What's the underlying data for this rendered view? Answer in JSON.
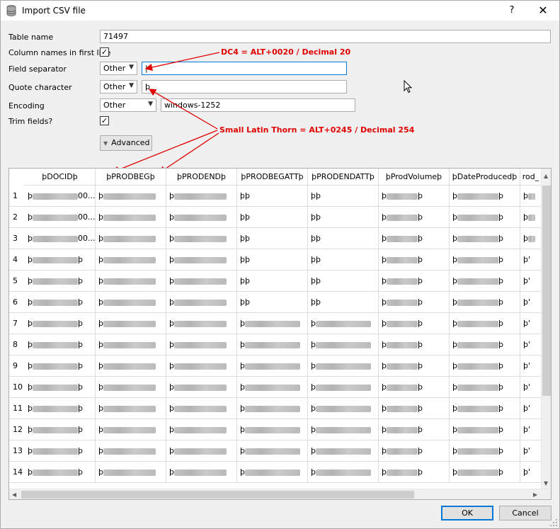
{
  "window": {
    "title": "Import CSV file",
    "help_glyph": "?",
    "close_glyph": "✕"
  },
  "form": {
    "table_name_label": "Table name",
    "table_name_value": "71497",
    "column_names_label": "Column names in first line",
    "column_names_checked": "✓",
    "field_separator_label": "Field separator",
    "field_separator_option": "Other",
    "field_separator_value": "|",
    "quote_char_label": "Quote character",
    "quote_char_option": "Other",
    "quote_char_value": "þ",
    "encoding_label": "Encoding",
    "encoding_option": "Other",
    "encoding_value": "windows-1252",
    "trim_fields_label": "Trim fields?",
    "trim_fields_checked": "✓",
    "advanced_label": "Advanced"
  },
  "annotations": {
    "dc4": "DC4 = ALT+0020 / Decimal 20",
    "thorn": "Small Latin Thorn = ALT+0245 / Decimal 254",
    "color": "#e00000"
  },
  "preview": {
    "columns": [
      "þDOCIDþ",
      "þPRODBEGþ",
      "þPRODENDþ",
      "þPRODBEGATTþ",
      "þPRODENDATTþ",
      "þProdVolumeþ",
      "þDateProducedþ",
      "rod_"
    ],
    "rows": [
      {
        "num": "1",
        "cells": [
          "þ▒▒▒▒▒00...",
          "þ▒▒▒▒▒▒▒",
          "þ▒▒▒▒▒▒▒",
          "þþ",
          "þþ",
          "þ▒▒▒▒þ",
          "þ▒▒▒▒▒▒þ",
          "þ▒"
        ]
      },
      {
        "num": "2",
        "cells": [
          "þ▒▒▒▒▒00...",
          "þ▒▒▒▒▒▒▒",
          "þ▒▒▒▒▒▒▒",
          "þþ",
          "þþ",
          "þ▒▒▒▒þ",
          "þ▒▒▒▒▒▒þ",
          "þ▒"
        ]
      },
      {
        "num": "3",
        "cells": [
          "þ▒▒▒▒▒00...",
          "þ▒▒▒▒▒▒▒",
          "þ▒▒▒▒▒▒▒",
          "þþ",
          "þþ",
          "þ▒▒▒▒þ",
          "þ▒▒▒▒▒▒þ",
          "þ▒"
        ]
      },
      {
        "num": "4",
        "cells": [
          "þ▒▒▒▒▒þ",
          "þ▒▒▒▒▒▒▒",
          "þ▒▒▒▒▒▒▒",
          "þþ",
          "þþ",
          "þ▒▒▒▒þ",
          "þ▒▒▒▒▒▒þ",
          "þ'"
        ]
      },
      {
        "num": "5",
        "cells": [
          "þ▒▒▒▒▒þ",
          "þ▒▒▒▒▒▒▒",
          "þ▒▒▒▒▒▒▒",
          "þþ",
          "þþ",
          "þ▒▒▒▒þ",
          "þ▒▒▒▒▒▒þ",
          "þ'"
        ]
      },
      {
        "num": "6",
        "cells": [
          "þ▒▒▒▒▒þ",
          "þ▒▒▒▒▒▒▒",
          "þ▒▒▒▒▒▒▒",
          "þþ",
          "þþ",
          "þ▒▒▒▒þ",
          "þ▒▒▒▒▒▒þ",
          "þ'"
        ]
      },
      {
        "num": "7",
        "cells": [
          "þ▒▒▒▒▒þ",
          "þ▒▒▒▒▒▒▒",
          "þ▒▒▒▒▒▒▒",
          "þ▒▒▒▒▒▒",
          "þ▒▒▒▒▒▒",
          "þ▒▒▒▒þ",
          "þ▒▒▒▒▒▒þ",
          "þ'"
        ]
      },
      {
        "num": "8",
        "cells": [
          "þ▒▒▒▒▒þ",
          "þ▒▒▒▒▒▒▒",
          "þ▒▒▒▒▒▒▒",
          "þ▒▒▒▒▒▒",
          "þ▒▒▒▒▒▒",
          "þ▒▒▒▒þ",
          "þ▒▒▒▒▒▒þ",
          "þ'"
        ]
      },
      {
        "num": "9",
        "cells": [
          "þ▒▒▒▒▒þ",
          "þ▒▒▒▒▒▒▒",
          "þ▒▒▒▒▒▒▒",
          "þ▒▒▒▒▒▒",
          "þ▒▒▒▒▒▒",
          "þ▒▒▒▒þ",
          "þ▒▒▒▒▒▒þ",
          "þ'"
        ]
      },
      {
        "num": "10",
        "cells": [
          "þ▒▒▒▒▒þ",
          "þ▒▒▒▒▒▒▒",
          "þ▒▒▒▒▒▒▒",
          "þ▒▒▒▒▒▒",
          "þ▒▒▒▒▒▒",
          "þ▒▒▒▒þ",
          "þ▒▒▒▒▒▒þ",
          "þ'"
        ]
      },
      {
        "num": "11",
        "cells": [
          "þ▒▒▒▒▒þ",
          "þ▒▒▒▒▒▒▒",
          "þ▒▒▒▒▒▒▒",
          "þ▒▒▒▒▒▒",
          "þ▒▒▒▒▒▒",
          "þ▒▒▒▒þ",
          "þ▒▒▒▒▒▒þ",
          "þ'"
        ]
      },
      {
        "num": "12",
        "cells": [
          "þ▒▒▒▒▒þ",
          "þ▒▒▒▒▒▒▒",
          "þ▒▒▒▒▒▒▒",
          "þ▒▒▒▒▒▒",
          "þ▒▒▒▒▒▒",
          "þ▒▒▒▒þ",
          "þ▒▒▒▒▒▒þ",
          "þ'"
        ]
      },
      {
        "num": "13",
        "cells": [
          "þ▒▒▒▒▒þ",
          "þ▒▒▒▒▒▒▒",
          "þ▒▒▒▒▒▒▒",
          "þ▒▒▒▒▒▒",
          "þ▒▒▒▒▒▒",
          "þ▒▒▒▒þ",
          "þ▒▒▒▒▒▒þ",
          "þ'"
        ]
      },
      {
        "num": "14",
        "cells": [
          "þ▒▒▒▒▒þ",
          "þ▒▒▒▒▒▒▒",
          "þ▒▒▒▒▒▒▒",
          "þ▒▒▒▒▒▒",
          "þ▒▒▒▒▒▒",
          "þ▒▒▒▒þ",
          "þ▒▒▒▒▒▒þ",
          "þ'"
        ]
      }
    ]
  },
  "buttons": {
    "ok": "OK",
    "cancel": "Cancel"
  },
  "colors": {
    "focus_border": "#0078d7",
    "annotation": "#e00000"
  }
}
